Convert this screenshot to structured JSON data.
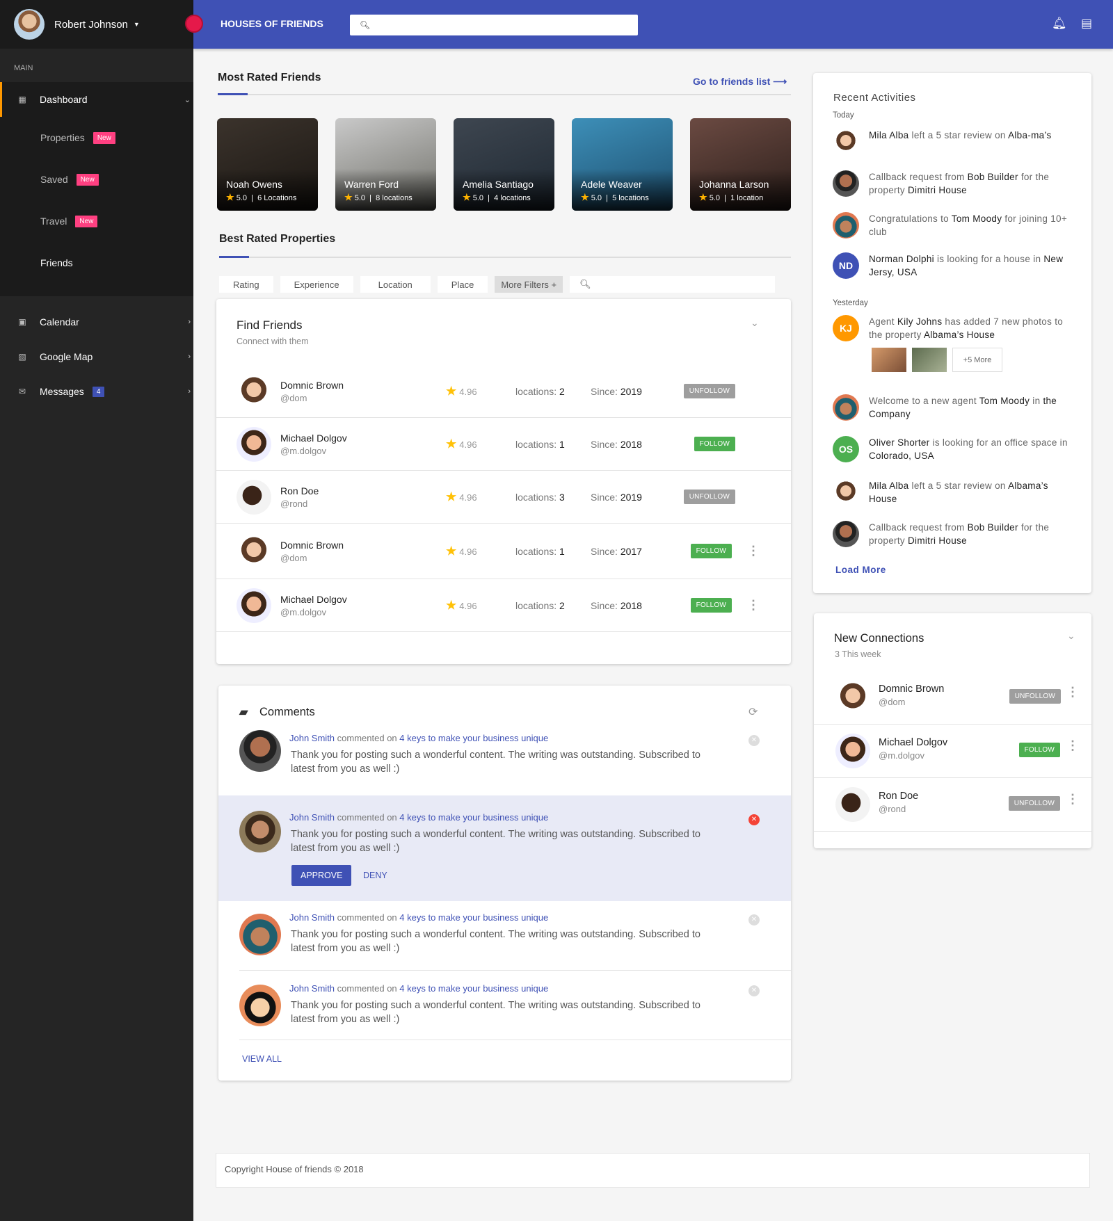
{
  "sidebar": {
    "user_name": "Robert Johnson",
    "section_label": "MAIN",
    "dashboard": "Dashboard",
    "sub_items": [
      {
        "label": "Properties",
        "badge": "New"
      },
      {
        "label": "Saved",
        "badge": "New"
      },
      {
        "label": "Travel",
        "badge": "New"
      },
      {
        "label": "Friends"
      }
    ],
    "items": [
      {
        "label": "Calendar"
      },
      {
        "label": "Google Map"
      },
      {
        "label": "Messages",
        "badge": "4"
      }
    ]
  },
  "topbar": {
    "brand": "HOUSES OF FRIENDS",
    "search_placeholder": ""
  },
  "most_rated": {
    "title": "Most Rated Friends",
    "link": "Go to friends list",
    "cards": [
      {
        "name": "Noah Owens",
        "rating": "5.0",
        "locations": "6 Locations"
      },
      {
        "name": "Warren Ford",
        "rating": "5.0",
        "locations": "8 locations"
      },
      {
        "name": "Amelia Santiago",
        "rating": "5.0",
        "locations": "4 locations"
      },
      {
        "name": "Adele Weaver",
        "rating": "5.0",
        "locations": "5 locations"
      },
      {
        "name": "Johanna Larson",
        "rating": "5.0",
        "locations": "1 location"
      }
    ]
  },
  "best_rated": {
    "title": "Best Rated Properties",
    "filters": [
      "Rating",
      "Experience",
      "Location",
      "Place",
      "More Filters +"
    ]
  },
  "find_friends": {
    "title": "Find Friends",
    "subtitle": "Connect with them",
    "locations_label": "locations:",
    "since_label": "Since:",
    "rows": [
      {
        "name": "Domnic Brown",
        "handle": "@dom",
        "rating": "4.96",
        "locations": "2",
        "since": "2019",
        "action": "UNFOLLOW"
      },
      {
        "name": "Michael Dolgov",
        "handle": "@m.dolgov",
        "rating": "4.96",
        "locations": "1",
        "since": "2018",
        "action": "FOLLOW"
      },
      {
        "name": "Ron Doe",
        "handle": "@rond",
        "rating": "4.96",
        "locations": "3",
        "since": "2019",
        "action": "UNFOLLOW"
      },
      {
        "name": "Domnic Brown",
        "handle": "@dom",
        "rating": "4.96",
        "locations": "1",
        "since": "2017",
        "action": "FOLLOW"
      },
      {
        "name": "Michael Dolgov",
        "handle": "@m.dolgov",
        "rating": "4.96",
        "locations": "2",
        "since": "2018",
        "action": "FOLLOW"
      }
    ]
  },
  "comments": {
    "title": "Comments",
    "view_all": "VIEW ALL",
    "approve": "APPROVE",
    "deny": "DENY",
    "items": [
      {
        "author": "John Smith",
        "verb": "commented on",
        "post": "4 keys to make your business unique",
        "text": "Thank you for posting such a wonderful content. The writing was outstanding. Subscribed to latest from you as well :)"
      },
      {
        "author": "John Smith",
        "verb": "commented on",
        "post": "4 keys to make your business unique",
        "text": "Thank you for posting such a wonderful content. The writing was outstanding. Subscribed to latest from you as well :)"
      },
      {
        "author": "John Smith",
        "verb": "commented on",
        "post": "4 keys to make your business unique",
        "text": "Thank you for posting such a wonderful content. The writing was outstanding. Subscribed to latest from you as well :)"
      },
      {
        "author": "John Smith",
        "verb": "commented on",
        "post": "4 keys to make your business unique",
        "text": "Thank you for posting such a wonderful content. The writing was outstanding. Subscribed to latest from you as well :)"
      }
    ]
  },
  "recent": {
    "title": "Recent Activities",
    "today": "Today",
    "yesterday": "Yesterday",
    "load_more": "Load More",
    "more_photos": "+5 More",
    "items": [
      {
        "parts": [
          [
            "b",
            "Mila Alba"
          ],
          [
            "t",
            " left a 5 star review on "
          ],
          [
            "b",
            "Alba-ma’s"
          ]
        ]
      },
      {
        "parts": [
          [
            "t",
            "Callback request from "
          ],
          [
            "b",
            "Bob Builder"
          ],
          [
            "t",
            " for the property "
          ],
          [
            "b",
            "Dimitri House"
          ]
        ]
      },
      {
        "parts": [
          [
            "t",
            "Congratulations to "
          ],
          [
            "b",
            "Tom Moody"
          ],
          [
            "t",
            " for joining 10+ club"
          ]
        ]
      },
      {
        "initials": "ND",
        "parts": [
          [
            "b",
            "Norman Dolphi"
          ],
          [
            "t",
            " is looking for a house in "
          ],
          [
            "b",
            "New Jersy, USA"
          ]
        ]
      },
      {
        "initials": "KJ",
        "parts": [
          [
            "t",
            "Agent "
          ],
          [
            "b",
            "Kily Johns"
          ],
          [
            "t",
            " has added 7 new photos to the property "
          ],
          [
            "b",
            "Albama’s House"
          ]
        ]
      },
      {
        "parts": [
          [
            "t",
            "Welcome to a new agent "
          ],
          [
            "b",
            "Tom Moody"
          ],
          [
            "t",
            " in "
          ],
          [
            "b",
            "the Company"
          ]
        ]
      },
      {
        "initials": "OS",
        "parts": [
          [
            "b",
            "Oliver Shorter"
          ],
          [
            "t",
            " is looking for an office space in "
          ],
          [
            "b",
            "Colorado, USA"
          ]
        ]
      },
      {
        "parts": [
          [
            "b",
            "Mila Alba"
          ],
          [
            "t",
            " left a 5 star review on "
          ],
          [
            "b",
            "Albama’s House"
          ]
        ]
      },
      {
        "parts": [
          [
            "t",
            "Callback request from "
          ],
          [
            "b",
            "Bob Builder"
          ],
          [
            "t",
            " for the property "
          ],
          [
            "b",
            "Dimitri House"
          ]
        ]
      }
    ]
  },
  "new_connections": {
    "title": "New Connections",
    "subtitle": "3 This week",
    "rows": [
      {
        "name": "Domnic Brown",
        "handle": "@dom",
        "action": "UNFOLLOW"
      },
      {
        "name": "Michael Dolgov",
        "handle": "@m.dolgov",
        "action": "FOLLOW"
      },
      {
        "name": "Ron Doe",
        "handle": "@rond",
        "action": "UNFOLLOW"
      }
    ]
  },
  "footer": {
    "text": "Copyright House of friends © 2018"
  },
  "colors": {
    "primary": "#3f51b5",
    "badge": "#ff4081",
    "follow": "#4caf50",
    "unfollow": "#9e9e9e",
    "accent": "#ff9800"
  }
}
